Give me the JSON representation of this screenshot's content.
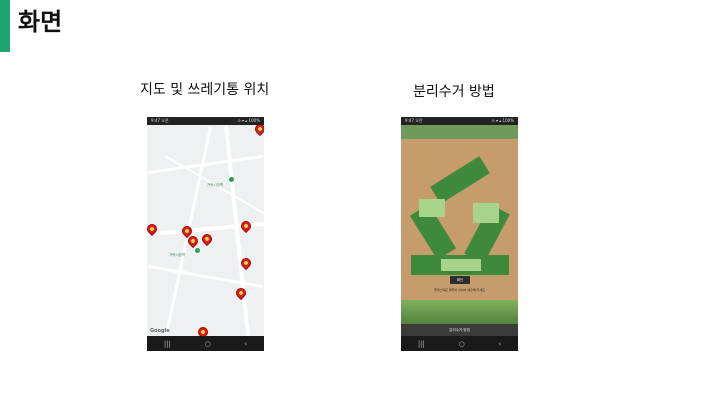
{
  "slide": {
    "title": "화면",
    "accent_color": "#1fa36f"
  },
  "captions": {
    "map": "지도 및 쓰레기통 위치",
    "recycling": "분리수거 방법"
  },
  "map_screen": {
    "status_time": "9:47 오전",
    "status_right": "⊙ ▾ ▴ 100%",
    "poi_labels": [
      "가락시장역",
      "가락시장역"
    ],
    "google_logo": "Google",
    "pin_icon": "trash-bin-pin-icon",
    "colors": {
      "pin": "#d61e1e",
      "poi": "#2e9e55"
    }
  },
  "recycle_screen": {
    "status_time": "9:47 오전",
    "status_right": "⊙ ▾ ▴ 100%",
    "button_label": "확인",
    "description": "플라스틱은 깨끗이 씻어서 배출해 주세요",
    "bottom_bar_label": "분리수거 방법",
    "colors": {
      "arrow": "#3f8a3a",
      "background": "#c69c6d"
    }
  },
  "navbar": {
    "recent_icon": "recent-apps-icon",
    "home_icon": "home-icon",
    "back_icon": "back-icon"
  }
}
